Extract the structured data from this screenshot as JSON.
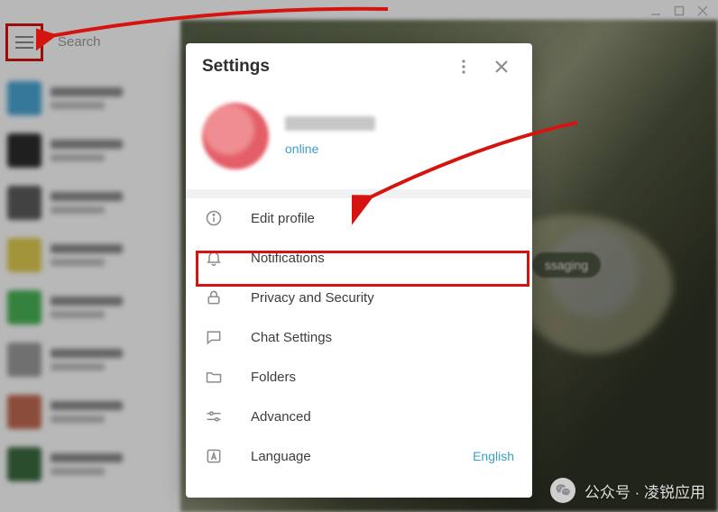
{
  "window": {
    "search_placeholder": "Search"
  },
  "background": {
    "badge_text": "ssaging"
  },
  "settings": {
    "title": "Settings",
    "profile": {
      "status": "online"
    },
    "menu": {
      "edit_profile": "Edit profile",
      "notifications": "Notifications",
      "privacy": "Privacy and Security",
      "chat_settings": "Chat Settings",
      "folders": "Folders",
      "advanced": "Advanced",
      "language_label": "Language",
      "language_value": "English"
    }
  },
  "watermark": {
    "text": "公众号 · 凌锐应用"
  }
}
